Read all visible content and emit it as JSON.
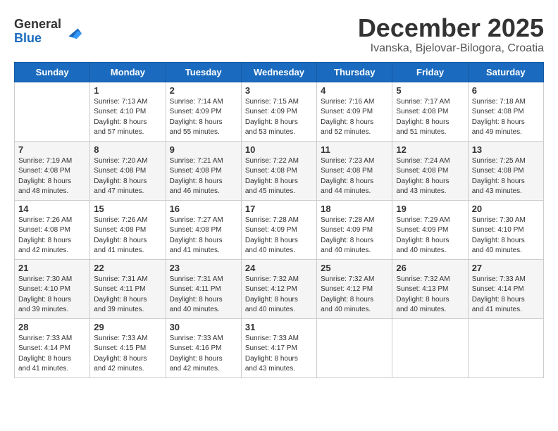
{
  "header": {
    "logo_line1": "General",
    "logo_line2": "Blue",
    "month": "December 2025",
    "location": "Ivanska, Bjelovar-Bilogora, Croatia"
  },
  "weekdays": [
    "Sunday",
    "Monday",
    "Tuesday",
    "Wednesday",
    "Thursday",
    "Friday",
    "Saturday"
  ],
  "weeks": [
    [
      {
        "day": "",
        "info": ""
      },
      {
        "day": "1",
        "info": "Sunrise: 7:13 AM\nSunset: 4:10 PM\nDaylight: 8 hours\nand 57 minutes."
      },
      {
        "day": "2",
        "info": "Sunrise: 7:14 AM\nSunset: 4:09 PM\nDaylight: 8 hours\nand 55 minutes."
      },
      {
        "day": "3",
        "info": "Sunrise: 7:15 AM\nSunset: 4:09 PM\nDaylight: 8 hours\nand 53 minutes."
      },
      {
        "day": "4",
        "info": "Sunrise: 7:16 AM\nSunset: 4:09 PM\nDaylight: 8 hours\nand 52 minutes."
      },
      {
        "day": "5",
        "info": "Sunrise: 7:17 AM\nSunset: 4:08 PM\nDaylight: 8 hours\nand 51 minutes."
      },
      {
        "day": "6",
        "info": "Sunrise: 7:18 AM\nSunset: 4:08 PM\nDaylight: 8 hours\nand 49 minutes."
      }
    ],
    [
      {
        "day": "7",
        "info": "Sunrise: 7:19 AM\nSunset: 4:08 PM\nDaylight: 8 hours\nand 48 minutes."
      },
      {
        "day": "8",
        "info": "Sunrise: 7:20 AM\nSunset: 4:08 PM\nDaylight: 8 hours\nand 47 minutes."
      },
      {
        "day": "9",
        "info": "Sunrise: 7:21 AM\nSunset: 4:08 PM\nDaylight: 8 hours\nand 46 minutes."
      },
      {
        "day": "10",
        "info": "Sunrise: 7:22 AM\nSunset: 4:08 PM\nDaylight: 8 hours\nand 45 minutes."
      },
      {
        "day": "11",
        "info": "Sunrise: 7:23 AM\nSunset: 4:08 PM\nDaylight: 8 hours\nand 44 minutes."
      },
      {
        "day": "12",
        "info": "Sunrise: 7:24 AM\nSunset: 4:08 PM\nDaylight: 8 hours\nand 43 minutes."
      },
      {
        "day": "13",
        "info": "Sunrise: 7:25 AM\nSunset: 4:08 PM\nDaylight: 8 hours\nand 43 minutes."
      }
    ],
    [
      {
        "day": "14",
        "info": "Sunrise: 7:26 AM\nSunset: 4:08 PM\nDaylight: 8 hours\nand 42 minutes."
      },
      {
        "day": "15",
        "info": "Sunrise: 7:26 AM\nSunset: 4:08 PM\nDaylight: 8 hours\nand 41 minutes."
      },
      {
        "day": "16",
        "info": "Sunrise: 7:27 AM\nSunset: 4:08 PM\nDaylight: 8 hours\nand 41 minutes."
      },
      {
        "day": "17",
        "info": "Sunrise: 7:28 AM\nSunset: 4:09 PM\nDaylight: 8 hours\nand 40 minutes."
      },
      {
        "day": "18",
        "info": "Sunrise: 7:28 AM\nSunset: 4:09 PM\nDaylight: 8 hours\nand 40 minutes."
      },
      {
        "day": "19",
        "info": "Sunrise: 7:29 AM\nSunset: 4:09 PM\nDaylight: 8 hours\nand 40 minutes."
      },
      {
        "day": "20",
        "info": "Sunrise: 7:30 AM\nSunset: 4:10 PM\nDaylight: 8 hours\nand 40 minutes."
      }
    ],
    [
      {
        "day": "21",
        "info": "Sunrise: 7:30 AM\nSunset: 4:10 PM\nDaylight: 8 hours\nand 39 minutes."
      },
      {
        "day": "22",
        "info": "Sunrise: 7:31 AM\nSunset: 4:11 PM\nDaylight: 8 hours\nand 39 minutes."
      },
      {
        "day": "23",
        "info": "Sunrise: 7:31 AM\nSunset: 4:11 PM\nDaylight: 8 hours\nand 40 minutes."
      },
      {
        "day": "24",
        "info": "Sunrise: 7:32 AM\nSunset: 4:12 PM\nDaylight: 8 hours\nand 40 minutes."
      },
      {
        "day": "25",
        "info": "Sunrise: 7:32 AM\nSunset: 4:12 PM\nDaylight: 8 hours\nand 40 minutes."
      },
      {
        "day": "26",
        "info": "Sunrise: 7:32 AM\nSunset: 4:13 PM\nDaylight: 8 hours\nand 40 minutes."
      },
      {
        "day": "27",
        "info": "Sunrise: 7:33 AM\nSunset: 4:14 PM\nDaylight: 8 hours\nand 41 minutes."
      }
    ],
    [
      {
        "day": "28",
        "info": "Sunrise: 7:33 AM\nSunset: 4:14 PM\nDaylight: 8 hours\nand 41 minutes."
      },
      {
        "day": "29",
        "info": "Sunrise: 7:33 AM\nSunset: 4:15 PM\nDaylight: 8 hours\nand 42 minutes."
      },
      {
        "day": "30",
        "info": "Sunrise: 7:33 AM\nSunset: 4:16 PM\nDaylight: 8 hours\nand 42 minutes."
      },
      {
        "day": "31",
        "info": "Sunrise: 7:33 AM\nSunset: 4:17 PM\nDaylight: 8 hours\nand 43 minutes."
      },
      {
        "day": "",
        "info": ""
      },
      {
        "day": "",
        "info": ""
      },
      {
        "day": "",
        "info": ""
      }
    ]
  ]
}
